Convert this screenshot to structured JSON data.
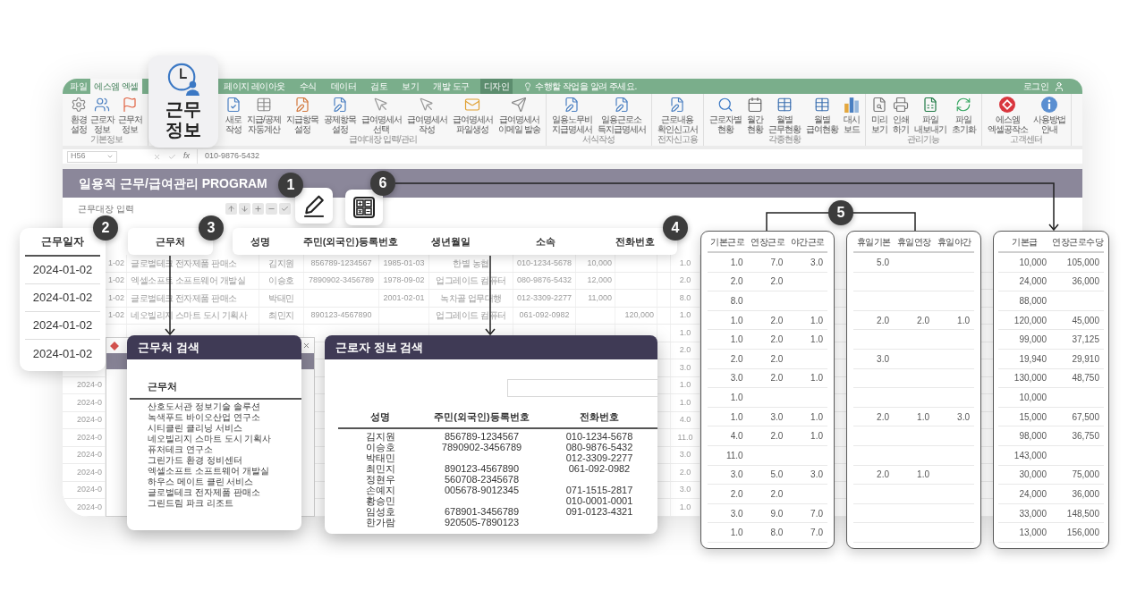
{
  "window": {
    "tabs": [
      {
        "label": "파일",
        "selected": false,
        "highlighted": false
      },
      {
        "label": "에스엠 엑셀",
        "selected": true,
        "highlighted": false
      },
      {
        "label": "페이지 레이아웃",
        "selected": false,
        "highlighted": false
      },
      {
        "label": "수식",
        "selected": false,
        "highlighted": false
      },
      {
        "label": "데이터",
        "selected": false,
        "highlighted": false
      },
      {
        "label": "검토",
        "selected": false,
        "highlighted": false
      },
      {
        "label": "보기",
        "selected": false,
        "highlighted": false
      },
      {
        "label": "개발 도구",
        "selected": false,
        "highlighted": false
      },
      {
        "label": "디자인",
        "selected": false,
        "highlighted": true
      }
    ],
    "tell_me": "수행할 작업을 알려 주세요.",
    "account": "로그인",
    "ribbon": [
      {
        "label": "기본정보",
        "buttons": [
          "환경\n설정",
          "근로자\n정보",
          "근무처\n정보"
        ]
      },
      {
        "label": "급여대장 입력/관리",
        "buttons": [
          "새로\n작성",
          "지급/공제\n자동계산",
          "지급항목\n설정",
          "공제항목\n설정",
          "급여명세서\n선택",
          "급여명세서\n작성",
          "급여명세서\n파일생성",
          "급여명세서\n이메일 발송"
        ]
      },
      {
        "label": "서식작성",
        "buttons": [
          "일용노무비\n지급명세서",
          "일용근로소\n득지급명세서"
        ]
      },
      {
        "label": "전자신고용",
        "buttons": [
          "근로내용\n확인신고서"
        ]
      },
      {
        "label": "각종현황",
        "buttons": [
          "근로자별\n현황",
          "월간\n현황",
          "월별\n근무현황",
          "월별\n급여현황",
          "대시\n보드"
        ]
      },
      {
        "label": "관리기능",
        "buttons": [
          "미리\n보기",
          "인쇄\n하기",
          "파일\n내보내기",
          "파일\n초기화"
        ]
      },
      {
        "label": "고객센터",
        "buttons": [
          "에스엠\n엑셀공작소",
          "사용방법\n안내"
        ]
      }
    ],
    "formula_bar": {
      "cell": "H56",
      "function": "fx",
      "value": "010-9876-5432"
    },
    "title": "일용직 근무/급여관리 PROGRAM",
    "section": "근무대장 입력",
    "sheet_rows": [
      {
        "kind": "full",
        "date": "1-02",
        "workplace": "글로벌테크 전자제품 판매소",
        "name": "김지원",
        "id_number": "856789-1234567",
        "birth": "1985-01-03",
        "affiliation": "한별 농협",
        "phone": "010-1234-5678",
        "pay": "10,000",
        "hours": "1.0"
      },
      {
        "kind": "full",
        "date": "1-02",
        "workplace": "엑셀소프트 소프트웨어 개발실",
        "name": "이승호",
        "id_number": "7890902-3456789",
        "birth": "1978-09-02",
        "affiliation": "업그레이드 컴퓨터",
        "phone": "080-9876-5432",
        "pay": "12,000",
        "hours": "2.0"
      },
      {
        "kind": "full",
        "date": "1-02",
        "workplace": "글로벌테크 전자제품 판매소",
        "name": "박태민",
        "birth": "2001-02-01",
        "affiliation": "녹차골 업무대행",
        "phone": "012-3309-2277",
        "pay": "11,000",
        "hours": "8.0"
      },
      {
        "kind": "full",
        "date": "1-02",
        "workplace": "네오빌리지 스마트 도시 기획사",
        "name": "최민지",
        "id_number": "890123-4567890",
        "affiliation": "업그레이드 컴퓨터",
        "phone": "061-092-0982",
        "allowance": "120,000",
        "hours": "1.0"
      },
      {
        "kind": "edge",
        "hours": "1.0"
      },
      {
        "kind": "edge",
        "hours": "2.0"
      },
      {
        "kind": "edge",
        "hours": "3.0"
      },
      {
        "kind": "edge",
        "date": "2024-0",
        "hours": "1.0"
      },
      {
        "kind": "edge",
        "date": "2024-0",
        "hours": "1.0"
      },
      {
        "kind": "edge",
        "date": "2024-0",
        "hours": "4.0"
      },
      {
        "kind": "edge",
        "date": "2024-0",
        "hours": "11.0"
      },
      {
        "kind": "edge",
        "date": "2024-0",
        "hours": "3.0"
      },
      {
        "kind": "edge",
        "date": "2024-0",
        "hours": "2.0"
      },
      {
        "kind": "edge",
        "date": "2024-0",
        "hours": "3.0"
      },
      {
        "kind": "edge",
        "date": "2024-0",
        "hours": "1.0"
      }
    ]
  },
  "shortcut": {
    "label": "근무정보"
  },
  "edit_button": {
    "badge": "1"
  },
  "calculator_button": {
    "badge": "6"
  },
  "date_callout": {
    "badge": "2",
    "header": "근무일자",
    "dates": [
      "2024-01-02",
      "2024-01-02",
      "2024-01-02",
      "2024-01-02"
    ]
  },
  "workplace_callout": {
    "badge": "3",
    "header": "근무처"
  },
  "worker_callout": {
    "badge": "4",
    "headers": [
      "성명",
      "주민(외국인)등록번호",
      "생년월일",
      "소속",
      "전화번호"
    ]
  },
  "workplace_search": {
    "title": "근무처 검색",
    "column": "근무처",
    "items": [
      "산호도서관 정보기술 솔루션",
      "녹색푸드 바이오산업 연구소",
      "시티클린 클리닝 서비스",
      "네오빌리지 스마트 도시 기획사",
      "퓨처테크 연구소",
      "그린가드 환경 정비센터",
      "엑셀소프트 소프트웨어 개발실",
      "하우스 메이트 클린 서비스",
      "글로벌테크 전자제품 판매소",
      "그린드림 파크 리조트"
    ]
  },
  "worker_search": {
    "title": "근로자 정보 검색",
    "columns": [
      "성명",
      "주민(외국인)등록번호",
      "전화번호"
    ],
    "rows": [
      {
        "name": "김지원",
        "id_number": "856789-1234567",
        "phone": "010-1234-5678"
      },
      {
        "name": "이승호",
        "id_number": "7890902-3456789",
        "phone": "080-9876-5432"
      },
      {
        "name": "박태민",
        "phone": "012-3309-2277"
      },
      {
        "name": "최민지",
        "id_number": "890123-4567890",
        "phone": "061-092-0982"
      },
      {
        "name": "정현우",
        "id_number": "560708-2345678"
      },
      {
        "name": "손예지",
        "id_number": "005678-9012345",
        "phone": "071-1515-2817"
      },
      {
        "name": "황승민",
        "phone": "010-0001-0001"
      },
      {
        "name": "임성호",
        "id_number": "678901-3456789",
        "phone": "091-0123-4321"
      },
      {
        "name": "한가람",
        "id_number": "920505-7890123"
      }
    ]
  },
  "hours_callout": {
    "badge": "5",
    "tables": [
      {
        "columns": [
          "기본근로",
          "연장근로",
          "야간근로"
        ],
        "rows": [
          [
            "1.0",
            "7.0",
            "3.0"
          ],
          [
            "2.0",
            "2.0",
            null
          ],
          [
            "8.0",
            null,
            null
          ],
          [
            "1.0",
            "2.0",
            "1.0"
          ],
          [
            "1.0",
            "2.0",
            "1.0"
          ],
          [
            "2.0",
            "2.0",
            null
          ],
          [
            "3.0",
            "2.0",
            "1.0"
          ],
          [
            "1.0",
            null,
            null
          ],
          [
            "1.0",
            "3.0",
            "1.0"
          ],
          [
            "4.0",
            "2.0",
            "1.0"
          ],
          [
            "11.0",
            null,
            null
          ],
          [
            "3.0",
            "5.0",
            "3.0"
          ],
          [
            "2.0",
            "2.0",
            null
          ],
          [
            "3.0",
            "9.0",
            "7.0"
          ],
          [
            "1.0",
            "8.0",
            "7.0"
          ]
        ]
      },
      {
        "columns": [
          "휴일기본",
          "휴일연장",
          "휴일야간"
        ],
        "rows": [
          [
            "5.0",
            null,
            null
          ],
          [
            null,
            null,
            null
          ],
          [
            null,
            null,
            null
          ],
          [
            "2.0",
            "2.0",
            "1.0"
          ],
          [
            null,
            null,
            null
          ],
          [
            "3.0",
            null,
            null
          ],
          [
            null,
            null,
            null
          ],
          [
            null,
            null,
            null
          ],
          [
            "2.0",
            "1.0",
            "3.0"
          ],
          [
            null,
            null,
            null
          ],
          [
            null,
            null,
            null
          ],
          [
            "2.0",
            "1.0",
            null
          ],
          [
            null,
            null,
            null
          ],
          [
            null,
            null,
            null
          ],
          [
            null,
            null,
            null
          ]
        ]
      }
    ]
  },
  "pay_table": {
    "columns": [
      "기본급",
      "연장근로수당"
    ],
    "rows": [
      [
        "10,000",
        "105,000"
      ],
      [
        "24,000",
        "36,000"
      ],
      [
        "88,000",
        null
      ],
      [
        "120,000",
        "45,000"
      ],
      [
        "99,000",
        "37,125"
      ],
      [
        "19,940",
        "29,910"
      ],
      [
        "130,000",
        "48,750"
      ],
      [
        "10,000",
        null
      ],
      [
        "15,000",
        "67,500"
      ],
      [
        "98,000",
        "36,750"
      ],
      [
        "143,000",
        null
      ],
      [
        "30,000",
        "75,000"
      ],
      [
        "24,000",
        "36,000"
      ],
      [
        "33,000",
        "148,500"
      ],
      [
        "13,000",
        "156,000"
      ]
    ]
  }
}
